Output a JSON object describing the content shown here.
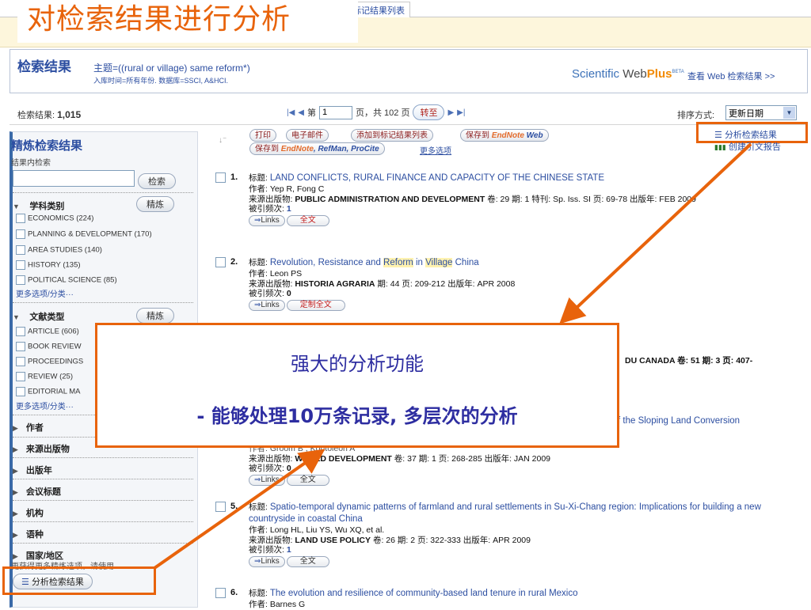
{
  "top": {
    "tab_partial": "标记结果列表",
    "slide_title": "对检索结果进行分析"
  },
  "header": {
    "title": "检索结果",
    "query": "主题=((rural or village) same reform*)",
    "sub": "入库时间=所有年份. 数据库=SSCI, A&HCI.",
    "sci_scientific": "Scientific ",
    "sci_web": "Web",
    "sci_plus": "Plus",
    "sci_beta": "BETA",
    "sci_link": "查看 Web 检索结果 >>"
  },
  "results_bar": {
    "label": "检索结果:",
    "count": "1,015",
    "page_prefix": "第",
    "page_value": "1",
    "page_suffix": "页，共 102 页",
    "go_button": "转至",
    "sort_label": "排序方式:",
    "sort_value": "更新日期"
  },
  "sidebar": {
    "title": "精炼检索结果",
    "search_within": "结果内检索",
    "search_button": "检索",
    "refine_button": "精炼",
    "subject_heading": "学科类别",
    "subject_items": [
      "ECONOMICS (224)",
      "PLANNING & DEVELOPMENT (170)",
      "AREA STUDIES (140)",
      "HISTORY (135)",
      "POLITICAL SCIENCE (85)"
    ],
    "more": "更多选项/分类···",
    "doctype_heading": "文献类型",
    "doctype_items": [
      "ARTICLE (606)",
      "BOOK REVIEW",
      "PROCEEDINGS",
      "REVIEW (25)",
      "EDITORIAL MA"
    ],
    "facets": [
      "作者",
      "来源出版物",
      "出版年",
      "会议标题",
      "机构",
      "语种",
      "国家/地区"
    ],
    "footnote": "更获得更多精炼选项，请使用",
    "analyze_button": "分析检索结果"
  },
  "toolbar": {
    "print": "打印",
    "email": "电子邮件",
    "add_marked": "添加到标记结果列表",
    "save_to": "保存到",
    "endnote": "EndNote",
    "web": "Web",
    "save_to2": "保存到",
    "endnote2": "EndNote",
    "refman": ", RefMan, ProCite",
    "more_options": "更多选项",
    "analyze_link": "分析检索结果",
    "citation_report": "创建引文报告"
  },
  "records": [
    {
      "num": "1.",
      "title": "LAND CONFLICTS, RURAL FINANCE AND CAPACITY OF THE CHINESE STATE",
      "authors": "作者: Yep R, Fong C",
      "source_label": "来源出版物:",
      "source": "PUBLIC ADMINISTRATION AND DEVELOPMENT",
      "details": "卷: 29  期: 1  特刊: Sp. Iss. SI  页: 69-78  出版年: FEB 2009",
      "cited_label": "被引频次:",
      "cited": "1",
      "links": "Links",
      "fulltext": "全文"
    },
    {
      "num": "2.",
      "title_a": "Revolution, Resistance and ",
      "title_hl1": "Reform",
      "title_b": " in ",
      "title_hl2": "Village",
      "title_c": " China",
      "authors": "作者: Leon PS",
      "source_label": "来源出版物:",
      "source": "HISTORIA AGRARIA",
      "details": "期: 44  页: 209-212  出版年: APR 2008",
      "cited_label": "被引频次:",
      "cited": "0",
      "links": "Links",
      "fulltext": "定制全文"
    },
    {
      "partial_source": "DU CANADA  卷: 51  期: 3  页: 407-",
      "partial_title": "f the Sloping Land Conversion"
    },
    {
      "authors_partial": "作者: Groom B , Kontoleon A",
      "source_label": "来源出版物:",
      "source": "WORLD DEVELOPMENT",
      "details": "卷: 37  期: 1  页: 268-285  出版年: JAN 2009",
      "cited_label": "被引频次:",
      "cited": "0",
      "links": "Links",
      "fulltext": "全文"
    },
    {
      "num": "5.",
      "title": "Spatio-temporal dynamic patterns of farmland and rural settlements in Su-Xi-Chang region: Implications for building a new countryside in coastal China",
      "authors": "作者: Long HL, Liu YS, Wu XQ, et al.",
      "source_label": "来源出版物:",
      "source": "LAND USE POLICY",
      "details": "卷: 26  期: 2  页: 322-333  出版年: APR 2009",
      "cited_label": "被引频次:",
      "cited": "1",
      "links": "Links",
      "fulltext": "全文"
    },
    {
      "num": "6.",
      "title": "The evolution and resilience of community-based land tenure in rural Mexico",
      "authors": "作者: Barnes G"
    }
  ],
  "callout": {
    "line1": "强大的分析功能",
    "line2": "- 能够处理10万条记录, 多层次的分析"
  },
  "colors": {
    "accent_orange": "#e8630b",
    "link_blue": "#2c4ea1",
    "callout_text": "#2e2ea1"
  }
}
